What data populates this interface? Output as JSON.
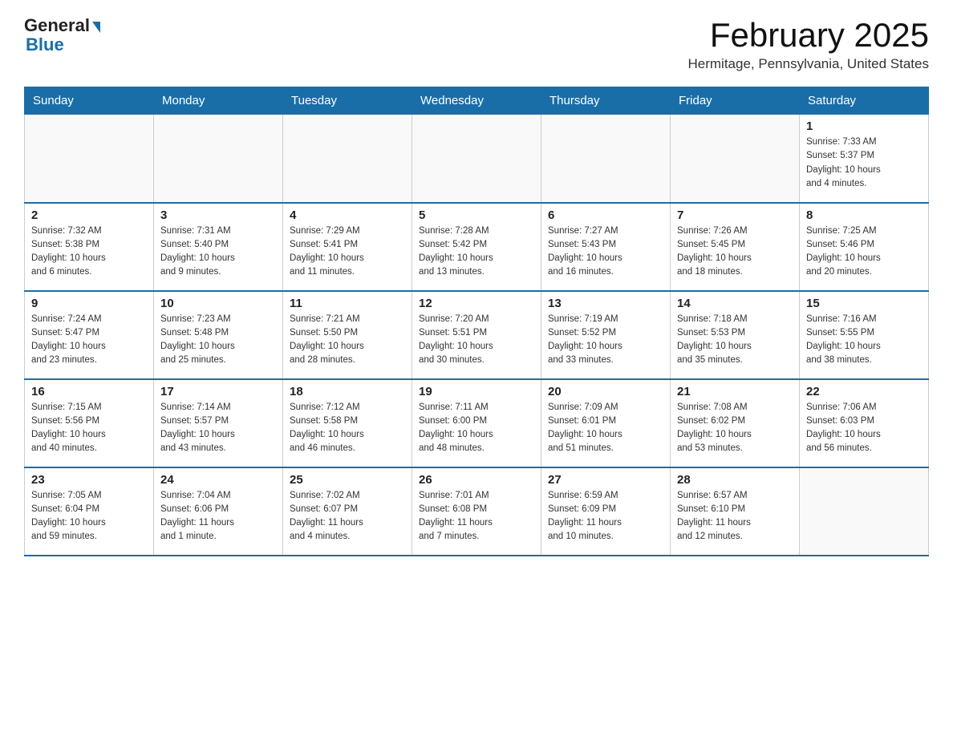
{
  "logo": {
    "general": "General",
    "blue": "Blue"
  },
  "title": "February 2025",
  "subtitle": "Hermitage, Pennsylvania, United States",
  "days_of_week": [
    "Sunday",
    "Monday",
    "Tuesday",
    "Wednesday",
    "Thursday",
    "Friday",
    "Saturday"
  ],
  "weeks": [
    [
      {
        "day": "",
        "info": ""
      },
      {
        "day": "",
        "info": ""
      },
      {
        "day": "",
        "info": ""
      },
      {
        "day": "",
        "info": ""
      },
      {
        "day": "",
        "info": ""
      },
      {
        "day": "",
        "info": ""
      },
      {
        "day": "1",
        "info": "Sunrise: 7:33 AM\nSunset: 5:37 PM\nDaylight: 10 hours\nand 4 minutes."
      }
    ],
    [
      {
        "day": "2",
        "info": "Sunrise: 7:32 AM\nSunset: 5:38 PM\nDaylight: 10 hours\nand 6 minutes."
      },
      {
        "day": "3",
        "info": "Sunrise: 7:31 AM\nSunset: 5:40 PM\nDaylight: 10 hours\nand 9 minutes."
      },
      {
        "day": "4",
        "info": "Sunrise: 7:29 AM\nSunset: 5:41 PM\nDaylight: 10 hours\nand 11 minutes."
      },
      {
        "day": "5",
        "info": "Sunrise: 7:28 AM\nSunset: 5:42 PM\nDaylight: 10 hours\nand 13 minutes."
      },
      {
        "day": "6",
        "info": "Sunrise: 7:27 AM\nSunset: 5:43 PM\nDaylight: 10 hours\nand 16 minutes."
      },
      {
        "day": "7",
        "info": "Sunrise: 7:26 AM\nSunset: 5:45 PM\nDaylight: 10 hours\nand 18 minutes."
      },
      {
        "day": "8",
        "info": "Sunrise: 7:25 AM\nSunset: 5:46 PM\nDaylight: 10 hours\nand 20 minutes."
      }
    ],
    [
      {
        "day": "9",
        "info": "Sunrise: 7:24 AM\nSunset: 5:47 PM\nDaylight: 10 hours\nand 23 minutes."
      },
      {
        "day": "10",
        "info": "Sunrise: 7:23 AM\nSunset: 5:48 PM\nDaylight: 10 hours\nand 25 minutes."
      },
      {
        "day": "11",
        "info": "Sunrise: 7:21 AM\nSunset: 5:50 PM\nDaylight: 10 hours\nand 28 minutes."
      },
      {
        "day": "12",
        "info": "Sunrise: 7:20 AM\nSunset: 5:51 PM\nDaylight: 10 hours\nand 30 minutes."
      },
      {
        "day": "13",
        "info": "Sunrise: 7:19 AM\nSunset: 5:52 PM\nDaylight: 10 hours\nand 33 minutes."
      },
      {
        "day": "14",
        "info": "Sunrise: 7:18 AM\nSunset: 5:53 PM\nDaylight: 10 hours\nand 35 minutes."
      },
      {
        "day": "15",
        "info": "Sunrise: 7:16 AM\nSunset: 5:55 PM\nDaylight: 10 hours\nand 38 minutes."
      }
    ],
    [
      {
        "day": "16",
        "info": "Sunrise: 7:15 AM\nSunset: 5:56 PM\nDaylight: 10 hours\nand 40 minutes."
      },
      {
        "day": "17",
        "info": "Sunrise: 7:14 AM\nSunset: 5:57 PM\nDaylight: 10 hours\nand 43 minutes."
      },
      {
        "day": "18",
        "info": "Sunrise: 7:12 AM\nSunset: 5:58 PM\nDaylight: 10 hours\nand 46 minutes."
      },
      {
        "day": "19",
        "info": "Sunrise: 7:11 AM\nSunset: 6:00 PM\nDaylight: 10 hours\nand 48 minutes."
      },
      {
        "day": "20",
        "info": "Sunrise: 7:09 AM\nSunset: 6:01 PM\nDaylight: 10 hours\nand 51 minutes."
      },
      {
        "day": "21",
        "info": "Sunrise: 7:08 AM\nSunset: 6:02 PM\nDaylight: 10 hours\nand 53 minutes."
      },
      {
        "day": "22",
        "info": "Sunrise: 7:06 AM\nSunset: 6:03 PM\nDaylight: 10 hours\nand 56 minutes."
      }
    ],
    [
      {
        "day": "23",
        "info": "Sunrise: 7:05 AM\nSunset: 6:04 PM\nDaylight: 10 hours\nand 59 minutes."
      },
      {
        "day": "24",
        "info": "Sunrise: 7:04 AM\nSunset: 6:06 PM\nDaylight: 11 hours\nand 1 minute."
      },
      {
        "day": "25",
        "info": "Sunrise: 7:02 AM\nSunset: 6:07 PM\nDaylight: 11 hours\nand 4 minutes."
      },
      {
        "day": "26",
        "info": "Sunrise: 7:01 AM\nSunset: 6:08 PM\nDaylight: 11 hours\nand 7 minutes."
      },
      {
        "day": "27",
        "info": "Sunrise: 6:59 AM\nSunset: 6:09 PM\nDaylight: 11 hours\nand 10 minutes."
      },
      {
        "day": "28",
        "info": "Sunrise: 6:57 AM\nSunset: 6:10 PM\nDaylight: 11 hours\nand 12 minutes."
      },
      {
        "day": "",
        "info": ""
      }
    ]
  ]
}
